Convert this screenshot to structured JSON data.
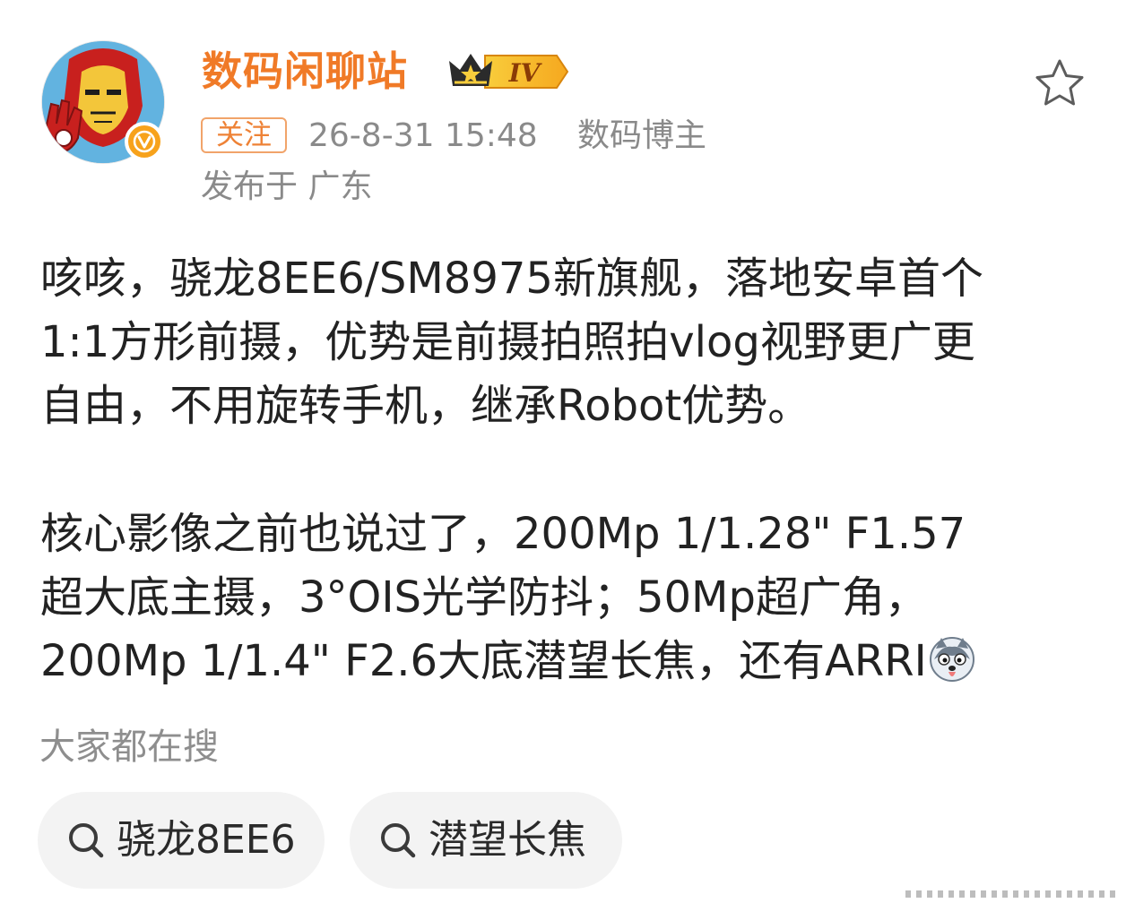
{
  "header": {
    "username": "数码闲聊站",
    "level": "IV",
    "follow_label": "关注",
    "timestamp": "26-8-31 15:48",
    "role": "数码博主",
    "location": "发布于 广东"
  },
  "post": {
    "lines": [
      "咳咳，骁龙8EE6/SM8975新旗舰，落地安卓首个",
      "1:1方形前摄，优势是前摄拍照拍vlog视野更广更",
      "自由，不用旋转手机，继承Robot优势。",
      "核心影像之前也说过了，200Mp 1/1.28\" F1.57",
      "超大底主摄，3°OIS光学防抖；50Mp超广角，",
      "200Mp 1/1.4\" F2.6大底潜望长焦，还有ARRI"
    ]
  },
  "search": {
    "heading": "大家都在搜",
    "chips": [
      "骁龙8EE6",
      "潜望长焦"
    ]
  },
  "icons": {
    "avatar": "iron-man-avatar",
    "verified": "verified-v-icon",
    "level_badge": "crown-level-icon",
    "favorite": "star-outline-icon",
    "search": "search-icon",
    "emoji": "husky-emoji-icon"
  },
  "colors": {
    "username": "#f07a27",
    "follow_border": "#f1a46a",
    "meta": "#8a8a8a",
    "chip_bg": "#f3f3f3"
  }
}
